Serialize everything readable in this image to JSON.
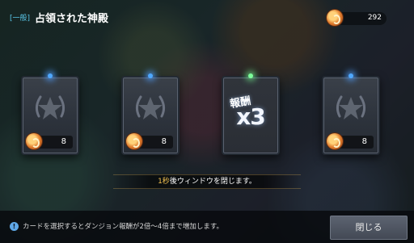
{
  "header": {
    "tag": "[一般]",
    "title": "占領された神殿"
  },
  "currency": {
    "icon": "coin-icon",
    "amount": "292"
  },
  "cards": [
    {
      "name": "card-1",
      "type": "reward",
      "emblem": "laurel-star-emblem",
      "icon": "coin-icon",
      "quantity": "8",
      "gem_color": "#4fa8ff"
    },
    {
      "name": "card-2",
      "type": "reward",
      "emblem": "laurel-star-emblem",
      "icon": "coin-icon",
      "quantity": "8",
      "gem_color": "#4fa8ff"
    },
    {
      "name": "card-3",
      "type": "multiplier",
      "kanji": "報酬",
      "multiplier": "x3",
      "gem_color": "#7dff9a"
    },
    {
      "name": "card-4",
      "type": "reward",
      "emblem": "laurel-star-emblem",
      "icon": "coin-icon",
      "quantity": "8",
      "gem_color": "#4fa8ff"
    }
  ],
  "countdown": {
    "seconds": "1秒",
    "text": "後ウィンドウを閉じます。"
  },
  "footer": {
    "info_icon": "info-icon",
    "text": "カードを選択するとダンジョン報酬が2倍〜4倍まで増加します。",
    "close_label": "閉じる"
  }
}
